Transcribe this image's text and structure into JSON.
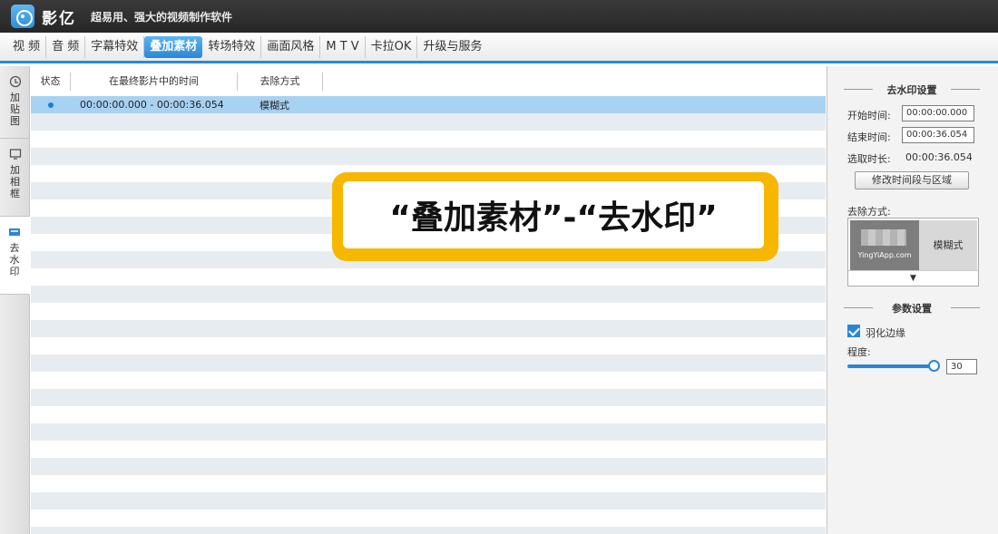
{
  "app": {
    "name": "影亿",
    "slogan": "超易用、强大的视频制作软件"
  },
  "menu": {
    "items": [
      "视 频",
      "音 频",
      "字幕特效",
      "叠加素材",
      "转场特效",
      "画面风格",
      "M T V",
      "卡拉OK",
      "升级与服务"
    ],
    "active_index": 3
  },
  "sidebar": {
    "tabs": [
      {
        "label": "加贴图",
        "icon": "sticker-icon"
      },
      {
        "label": "加相框",
        "icon": "frame-icon"
      },
      {
        "label": "去水印",
        "icon": "watermark-icon"
      }
    ],
    "active_index": 2
  },
  "list": {
    "headers": [
      "状态",
      "在最终影片中的时间",
      "去除方式"
    ],
    "rows": [
      {
        "time": "00:00:00.000 - 00:00:36.054",
        "method": "模糊式"
      }
    ]
  },
  "banner": {
    "text": "“叠加素材”-“去水印”"
  },
  "panel": {
    "section1_title": "去水印设置",
    "start_label": "开始时间:",
    "start_value": "00:00:00.000",
    "end_label": "结束时间:",
    "end_value": "00:00:36.054",
    "duration_label": "选取时长:",
    "duration_value": "00:00:36.054",
    "modify_button": "修改时间段与区域",
    "method_label": "去除方式:",
    "thumb_text": "YingYiApp.com",
    "method_option": "模糊式",
    "method_arrow": "▼",
    "section2_title": "参数设置",
    "feather_label": "羽化边缘",
    "feather_checked": true,
    "degree_label": "程度:",
    "degree_value": "30",
    "degree_level": 1.0
  },
  "colors": {
    "accent": "#2a86d5",
    "banner": "#f7b700",
    "selected_row": "#a8d2f2"
  }
}
